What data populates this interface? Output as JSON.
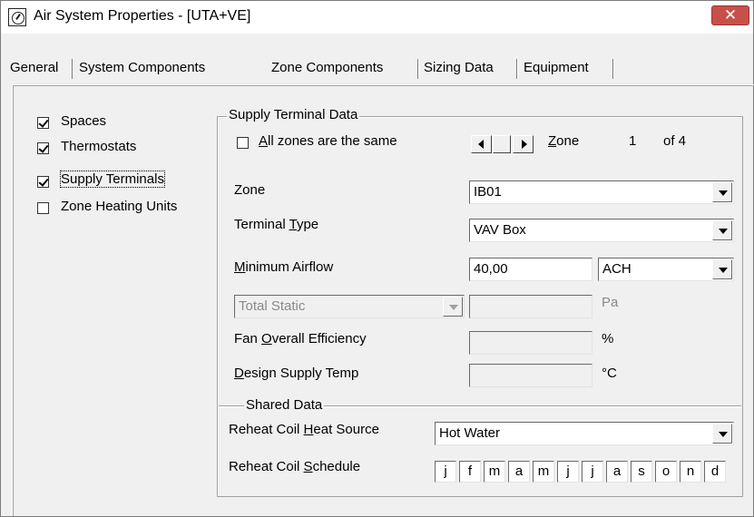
{
  "window": {
    "title": "Air System Properties - [UTA+VE]",
    "close_glyph": "✕"
  },
  "tabs": [
    "General",
    "System Components",
    "Zone Components",
    "Sizing Data",
    "Equipment"
  ],
  "active_tab": "Zone Components",
  "left_list": [
    {
      "label": "Spaces",
      "checked": true
    },
    {
      "label": "Thermostats",
      "checked": true
    },
    {
      "label": "Supply Terminals",
      "checked": true
    },
    {
      "label": "Zone Heating Units",
      "checked": false
    }
  ],
  "supply": {
    "group_title": "Supply Terminal Data",
    "all_same": {
      "pre": "",
      "mnemonic": "A",
      "post": "ll zones are the same",
      "checked": false
    },
    "zone_nav": {
      "label_mnemonic": "Z",
      "label_rest": "one",
      "current": "1",
      "of": "of 4"
    },
    "zone": {
      "label": "Zone",
      "value": "IB01"
    },
    "terminal_type": {
      "label_pre": "Terminal ",
      "mnemonic": "T",
      "label_post": "ype",
      "value": "VAV Box"
    },
    "min_airflow": {
      "mnemonic": "M",
      "label_post": "inimum Airflow",
      "value": "40,00",
      "unit": "ACH"
    },
    "total_static": {
      "value": "Total Static",
      "value_field": "",
      "unit": "Pa"
    },
    "fan_eff": {
      "label_pre": "Fan ",
      "mnemonic": "O",
      "label_post": "verall Efficiency",
      "value": "",
      "unit": "%"
    },
    "design_supply": {
      "mnemonic": "D",
      "label_post": "esign Supply Temp",
      "value": "",
      "unit": "°C"
    }
  },
  "shared": {
    "title": "Shared Data",
    "reheat_source": {
      "label_pre": "Reheat Coil ",
      "mnemonic": "H",
      "label_post": "eat Source",
      "value": "Hot Water"
    },
    "reheat_schedule": {
      "label_pre": "Reheat Coil ",
      "mnemonic": "S",
      "label_post": "chedule",
      "months": [
        "j",
        "f",
        "m",
        "a",
        "m",
        "j",
        "j",
        "a",
        "s",
        "o",
        "n",
        "d"
      ]
    }
  }
}
